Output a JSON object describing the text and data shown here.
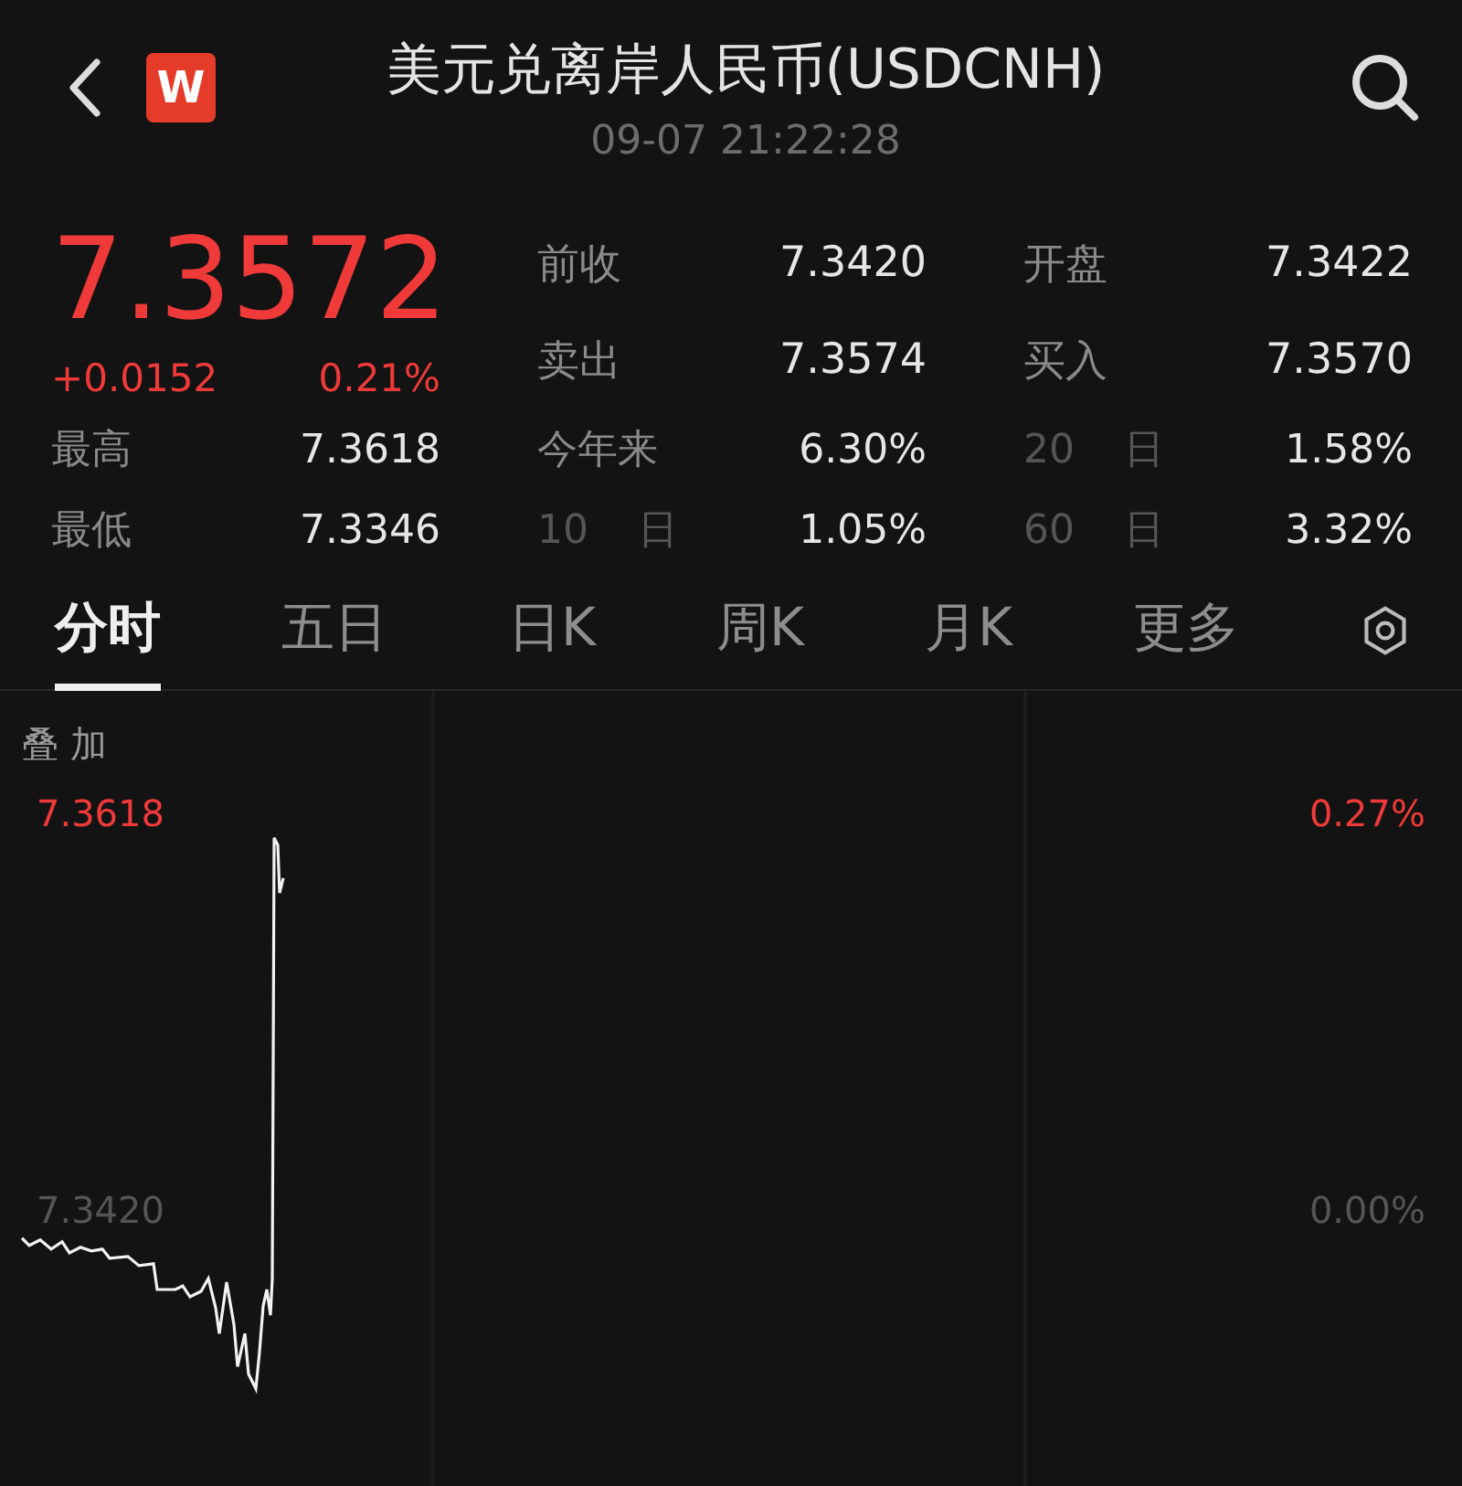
{
  "header": {
    "logo_letter": "W",
    "title": "美元兑离岸人民币(USDCNH)",
    "timestamp": "09-07 21:22:28"
  },
  "quote": {
    "price": "7.3572",
    "change": "+0.0152",
    "change_percent": "0.21%"
  },
  "top_stats": [
    {
      "label": "前收",
      "value": "7.3420"
    },
    {
      "label": "开盘",
      "value": "7.3422"
    },
    {
      "label": "卖出",
      "value": "7.3574"
    },
    {
      "label": "买入",
      "value": "7.3570"
    }
  ],
  "stats": [
    {
      "kind": "field",
      "label": "最高",
      "value": "7.3618"
    },
    {
      "kind": "field",
      "label": "今年来",
      "value": "6.30%"
    },
    {
      "kind": "period",
      "label": "20 日",
      "value": "1.58%"
    },
    {
      "kind": "field",
      "label": "最低",
      "value": "7.3346"
    },
    {
      "kind": "period",
      "label": "10 日",
      "value": "1.05%"
    },
    {
      "kind": "period",
      "label": "60 日",
      "value": "3.32%"
    }
  ],
  "tabs": [
    {
      "label": "分时",
      "selected": true
    },
    {
      "label": "五日",
      "selected": false
    },
    {
      "label": "日K",
      "selected": false
    },
    {
      "label": "周K",
      "selected": false
    },
    {
      "label": "月K",
      "selected": false
    },
    {
      "label": "更多",
      "selected": false
    }
  ],
  "chart": {
    "overlay_label": "叠 加",
    "high_price": "7.3618",
    "high_percent": "0.27%",
    "base_price": "7.3420",
    "base_percent": "0.00%"
  }
}
